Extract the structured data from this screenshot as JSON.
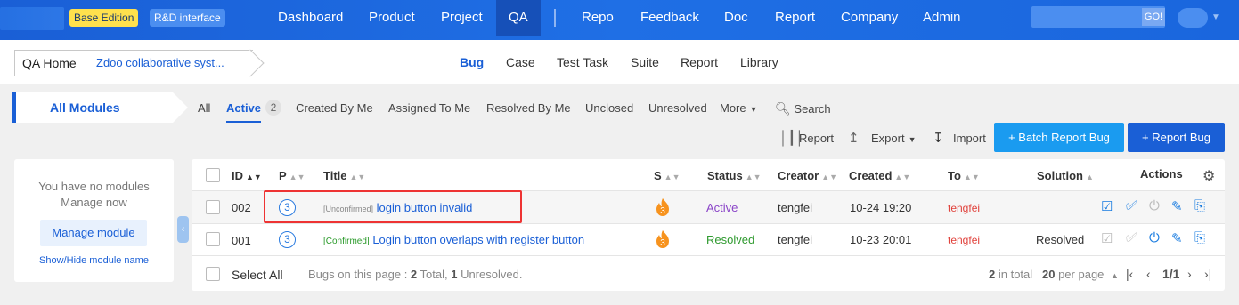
{
  "topnav": {
    "edition": "Base Edition",
    "rd_interface": "R&D interface",
    "items": [
      "Dashboard",
      "Product",
      "Project",
      "QA",
      "Repo",
      "Feedback",
      "Doc",
      "Report",
      "Company",
      "Admin"
    ],
    "active": "QA",
    "go_label": "GO!"
  },
  "subnav": {
    "home": "QA Home",
    "product": "Zdoo collaborative syst...",
    "items": [
      "Bug",
      "Case",
      "Test Task",
      "Suite",
      "Report",
      "Library"
    ],
    "active": "Bug"
  },
  "modules_tab": "All Modules",
  "filters": {
    "items": [
      "All",
      "Active",
      "Created By Me",
      "Assigned To Me",
      "Resolved By Me",
      "Unclosed",
      "Unresolved",
      "More",
      "Search"
    ],
    "active_count": "2"
  },
  "toolbar": {
    "report": "Report",
    "export": "Export",
    "import": "Import",
    "batch_report": "+ Batch Report Bug",
    "report_bug": "+ Report Bug"
  },
  "left_panel": {
    "no_modules": "You have no modules",
    "manage_now": "Manage now",
    "manage_btn": "Manage module",
    "show_hide": "Show/Hide module name"
  },
  "table": {
    "headers": [
      "ID",
      "P",
      "Title",
      "S",
      "Status",
      "Creator",
      "Created",
      "To",
      "Solution",
      "Actions"
    ],
    "rows": [
      {
        "id": "002",
        "pri": "3",
        "tag": "[Unconfirmed]",
        "title": "login button invalid",
        "sev": "3",
        "status": "Active",
        "creator": "tengfei",
        "created": "10-24 19:20",
        "to": "tengfei",
        "solution": ""
      },
      {
        "id": "001",
        "pri": "3",
        "tag": "[Confirmed]",
        "title": "Login button overlaps with register button",
        "sev": "3",
        "status": "Resolved",
        "creator": "tengfei",
        "created": "10-23 20:01",
        "to": "tengfei",
        "solution": "Resolved"
      }
    ]
  },
  "footer": {
    "select_all": "Select All",
    "summary_prefix": "Bugs on this page : ",
    "total": "2",
    "total_label": " Total, ",
    "unresolved": "1",
    "unresolved_label": " Unresolved.",
    "in_total_num": "2",
    "in_total_label": " in total",
    "per_page_num": "20",
    "per_page_label": " per page",
    "page": "1/1"
  },
  "colors": {
    "brand": "#1a5fd6",
    "accent_btn": "#1a9bf0",
    "highlight": "#e33333"
  }
}
